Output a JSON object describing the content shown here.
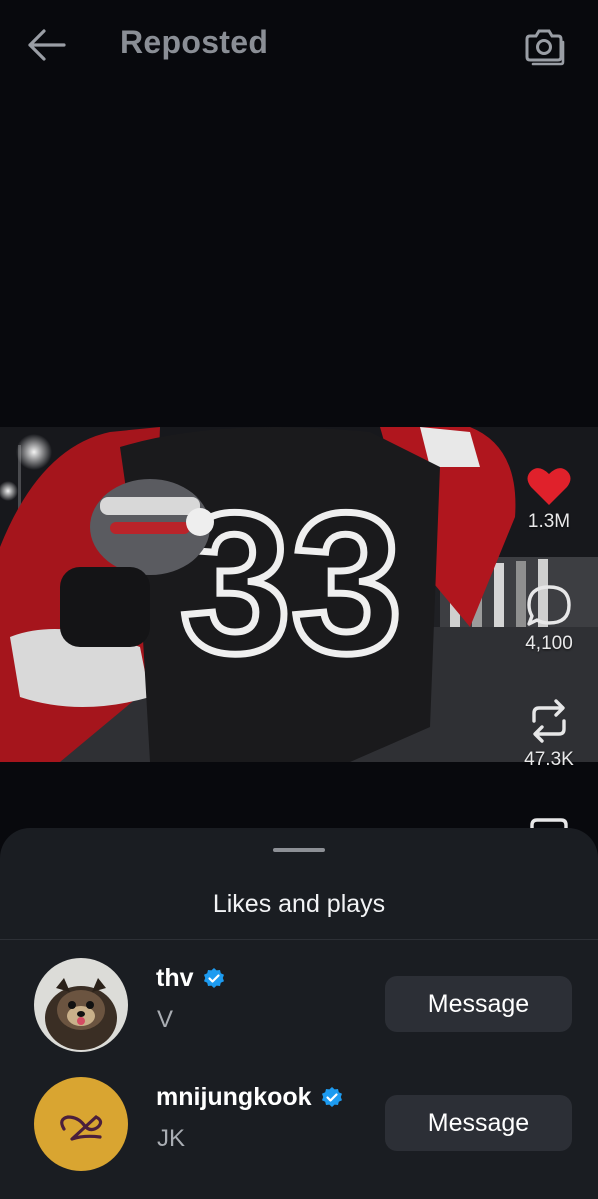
{
  "header": {
    "title": "Reposted",
    "back_icon": "arrow-left-icon",
    "camera_icon": "camera-icon"
  },
  "post": {
    "actions": {
      "likes": {
        "icon": "heart-icon",
        "count": "1.3M",
        "color": "#e0212b"
      },
      "comments": {
        "icon": "comment-icon",
        "count": "4,100"
      },
      "reposts": {
        "icon": "repost-icon",
        "count": "47.3K"
      }
    }
  },
  "sheet": {
    "title": "Likes and plays",
    "users": [
      {
        "username": "thv",
        "display_name": "V",
        "verified": true,
        "button_label": "Message"
      },
      {
        "username": "mnijungkook",
        "display_name": "JK",
        "verified": true,
        "button_label": "Message"
      }
    ]
  },
  "colors": {
    "background": "#08090d",
    "sheet": "#1a1d22",
    "button": "#2c2f36",
    "verified": "#1d9bf0",
    "heart": "#e0212b"
  }
}
